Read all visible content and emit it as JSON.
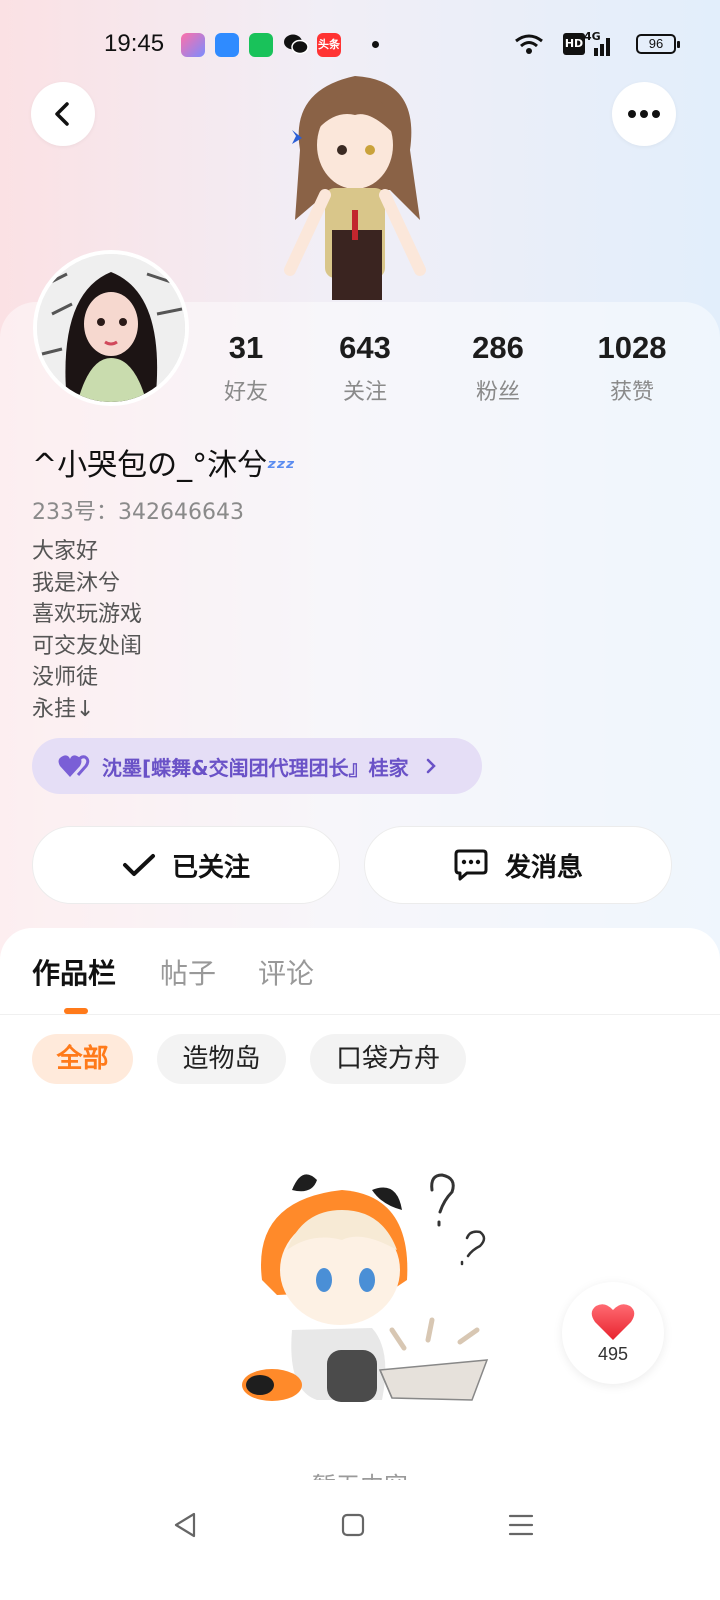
{
  "status_bar": {
    "time": "19:45",
    "apps": [
      "app-icon-1",
      "app-icon-2",
      "app-icon-3",
      "wechat-icon",
      "toutiao-icon"
    ],
    "toutiao_label": "头条",
    "hd": "HD",
    "network": "4G",
    "battery": "96"
  },
  "profile": {
    "stats": [
      {
        "value": "31",
        "label": "好友"
      },
      {
        "value": "643",
        "label": "关注"
      },
      {
        "value": "286",
        "label": "粉丝"
      },
      {
        "value": "1028",
        "label": "获赞"
      }
    ],
    "username": "^小哭包の_°沐兮",
    "uid": "233号：342646643",
    "bio": [
      "大家好",
      "我是沐兮",
      "喜欢玩游戏",
      "可交友处闺",
      "没师徒",
      "永挂↓"
    ],
    "tag": "沈墨[蝶舞&交闺团代理团长』桂家"
  },
  "actions": {
    "follow_label": "已关注",
    "message_label": "发消息"
  },
  "tabs": [
    {
      "label": "作品栏",
      "active": true
    },
    {
      "label": "帖子",
      "active": false
    },
    {
      "label": "评论",
      "active": false
    }
  ],
  "filters": [
    {
      "label": "全部",
      "active": true
    },
    {
      "label": "造物岛",
      "active": false
    },
    {
      "label": "口袋方舟",
      "active": false
    }
  ],
  "empty_text": "暂无内容",
  "like": {
    "count": "495"
  },
  "colors": {
    "accent": "#ff7a1a",
    "tag_bg": "#e5def6",
    "tag_text": "#6a52c7",
    "like_red": "#ff3b47"
  }
}
